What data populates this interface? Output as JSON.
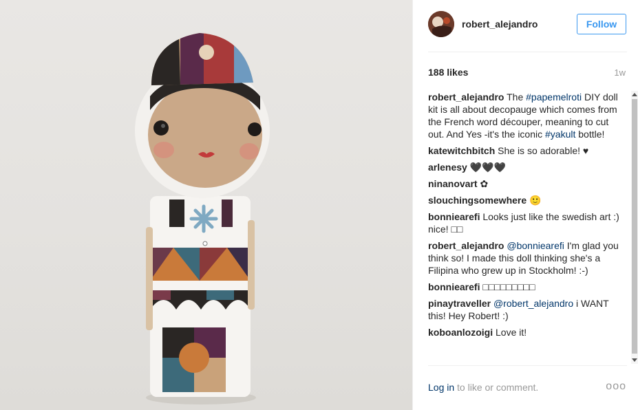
{
  "post": {
    "username": "robert_alejandro",
    "follow_label": "Follow",
    "likes": "188 likes",
    "time": "1w",
    "icons": {
      "avatar": "avatar-image",
      "more": "ellipsis-icon"
    }
  },
  "caption": {
    "user": "robert_alejandro",
    "t1": " The ",
    "tag1": "#papemelroti",
    "t2": " DIY doll kit is all about decopauge which comes from the French word découper, meaning to cut out. And Yes -it's the iconic ",
    "tag2": "#yakult",
    "t3": " bottle!"
  },
  "comments": [
    {
      "user": "katewitchbitch",
      "text": " She is so adorable! ♥"
    },
    {
      "user": "arlenesy",
      "text": " 🖤🖤🖤"
    },
    {
      "user": "ninanovart",
      "text": " ✿"
    },
    {
      "user": "slouchingsomewhere",
      "text": " 🙂"
    },
    {
      "user": "bonniearefi",
      "text": " Looks just like the swedish art :) nice! □□"
    },
    {
      "user": "robert_alejandro",
      "mention": "@bonniearefi",
      "text": " I'm glad you think so! I made this doll thinking she's a Filipina who grew up in Stockholm! :-)"
    },
    {
      "user": "bonniearefi",
      "text": " □□□□□□□□□"
    },
    {
      "user": "pinaytraveller",
      "mention": "@robert_alejandro",
      "text": " i WANT this! Hey Robert! :)"
    },
    {
      "user": "koboanlozoigi",
      "text": " Love it!"
    }
  ],
  "footer": {
    "login": "Log in",
    "rest": " to like or comment.",
    "more": "ooo"
  }
}
